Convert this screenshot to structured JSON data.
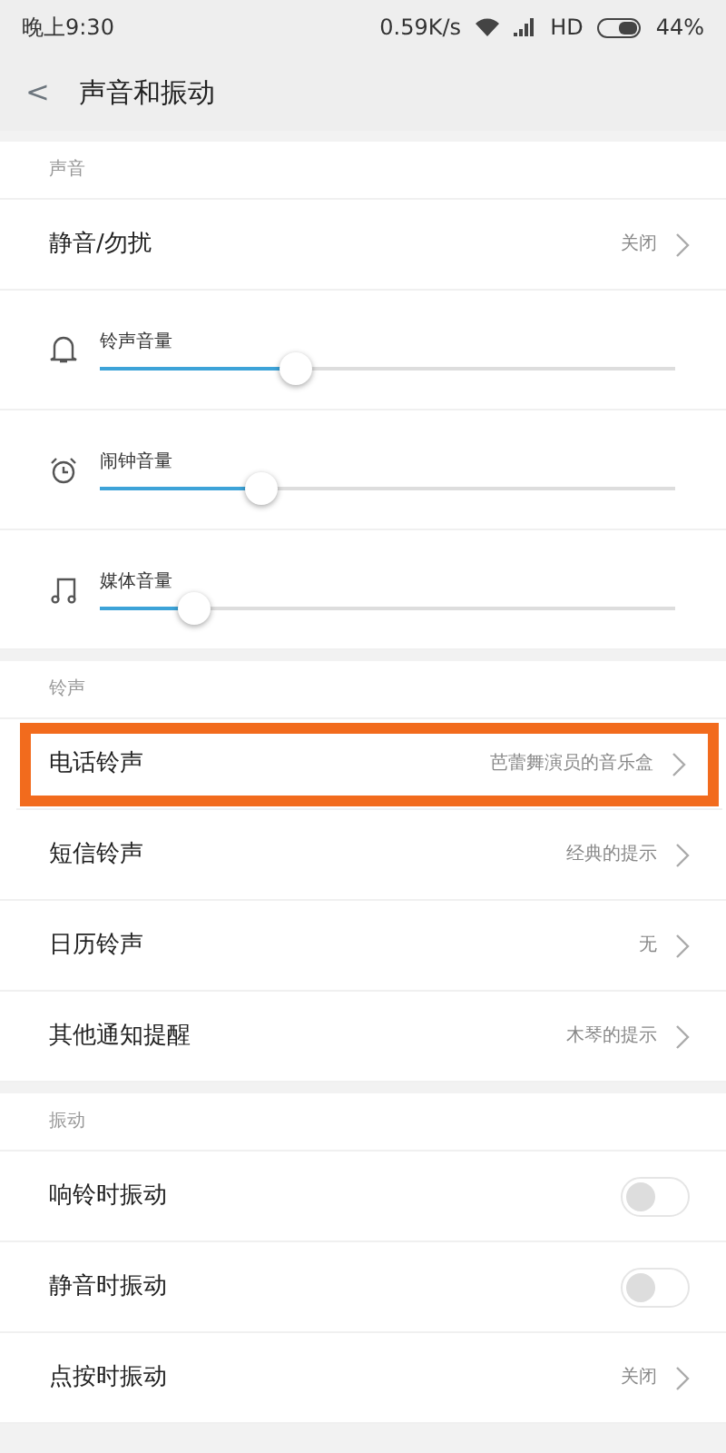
{
  "status_bar": {
    "time": "晚上9:30",
    "speed": "0.59K/s",
    "network": "HD",
    "battery": "44%"
  },
  "header": {
    "back": "<",
    "title": "声音和振动"
  },
  "sections": [
    {
      "title": "声音",
      "items": [
        {
          "kind": "link",
          "label": "静音/勿扰",
          "value": "关闭",
          "highlighted": false
        },
        {
          "kind": "slider",
          "label": "铃声音量",
          "level": 0.34
        },
        {
          "kind": "slider",
          "label": "闹钟音量",
          "level": 0.28
        },
        {
          "kind": "slider",
          "label": "媒体音量",
          "level": 0.165
        }
      ]
    },
    {
      "title": "铃声",
      "items": [
        {
          "kind": "link",
          "label": "电话铃声",
          "value": "芭蕾舞演员的音乐盒",
          "highlighted": true
        },
        {
          "kind": "link",
          "label": "短信铃声",
          "value": "经典的提示",
          "highlighted": false
        },
        {
          "kind": "link",
          "label": "日历铃声",
          "value": "无",
          "highlighted": false
        },
        {
          "kind": "link",
          "label": "其他通知提醒",
          "value": "木琴的提示",
          "highlighted": false
        }
      ]
    },
    {
      "title": "振动",
      "items": [
        {
          "kind": "toggle",
          "label": "响铃时振动",
          "on": false
        },
        {
          "kind": "toggle",
          "label": "静音时振动",
          "on": false
        },
        {
          "kind": "link",
          "label": "点按时振动",
          "value": "关闭",
          "highlighted": false
        }
      ]
    }
  ]
}
